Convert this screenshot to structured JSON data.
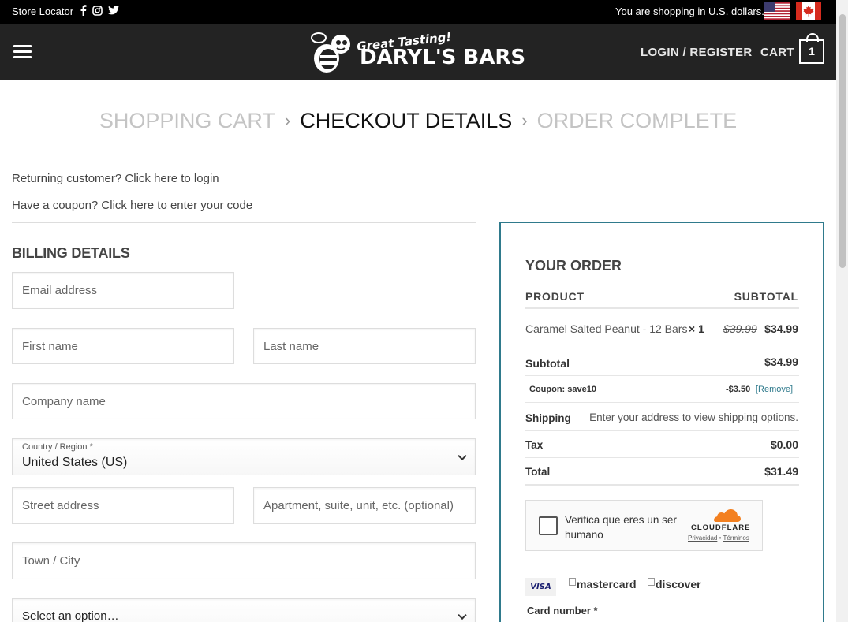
{
  "topbar": {
    "store_locator": "Store Locator",
    "social_icons": [
      "facebook-icon",
      "instagram-icon",
      "twitter-icon"
    ],
    "currency_notice": "You are shopping in U.S. dollars.",
    "flags": [
      "us-flag-icon",
      "canada-flag-icon"
    ]
  },
  "header": {
    "logo_tagline": "Great Tasting!",
    "logo_brand": "DARYL'S BARS",
    "login": "LOGIN / REGISTER",
    "cart_label": "CART",
    "cart_count": "1"
  },
  "breadcrumb": {
    "step1": "SHOPPING CART",
    "step2": "CHECKOUT DETAILS",
    "step3": "ORDER COMPLETE",
    "separator": "›"
  },
  "notices": {
    "returning": "Returning customer? Click here to login",
    "coupon": "Have a coupon? Click here to enter your code"
  },
  "billing": {
    "title": "BILLING DETAILS",
    "email_placeholder": "Email address",
    "first_name_placeholder": "First name",
    "last_name_placeholder": "Last name",
    "company_placeholder": "Company name",
    "country_label": "Country / Region *",
    "country_value": "United States (US)",
    "street_placeholder": "Street address",
    "apartment_placeholder": "Apartment, suite, unit, etc. (optional)",
    "city_placeholder": "Town / City",
    "state_value": "Select an option…"
  },
  "order": {
    "title": "YOUR ORDER",
    "col_product": "PRODUCT",
    "col_subtotal": "SUBTOTAL",
    "item_name": "Caramel Salted Peanut - 12 Bars",
    "item_qty": "× 1",
    "item_old_price": "$39.99",
    "item_price": "$34.99",
    "subtotal_label": "Subtotal",
    "subtotal_value": "$34.99",
    "coupon_label": "Coupon: save10",
    "coupon_value": "-$3.50",
    "coupon_remove": "[Remove]",
    "shipping_label": "Shipping",
    "shipping_value": "Enter your address to view shipping options.",
    "tax_label": "Tax",
    "tax_value": "$0.00",
    "total_label": "Total",
    "total_value": "$31.49"
  },
  "captcha": {
    "text": "Verifica que eres un ser humano",
    "brand": "CLOUDFLARE",
    "privacy": "Privacidad",
    "dot": "•",
    "terms": "Términos"
  },
  "payment": {
    "visa": "VISA",
    "mastercard": "mastercard",
    "discover": "discover",
    "card_number_label": "Card number *"
  },
  "colors": {
    "topbar_bg": "#000000",
    "header_bg": "#232323",
    "order_border": "#2f7a8c",
    "cloudflare_orange": "#f38020"
  }
}
